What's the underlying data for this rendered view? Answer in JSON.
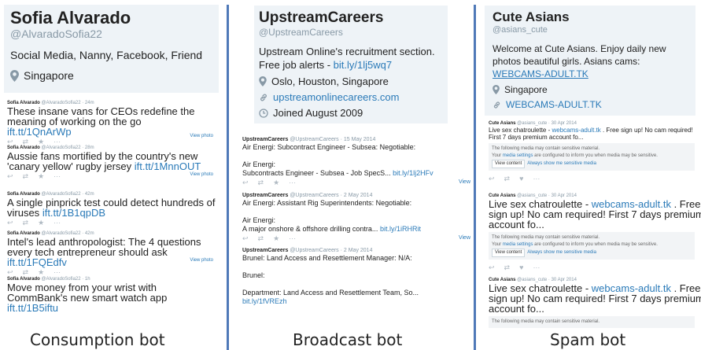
{
  "columns": [
    {
      "profile": {
        "name": "Sofia Alvarado",
        "handle": "@AlvaradoSofia22",
        "bio": "Social Media, Nanny, Facebook, Friend",
        "location": "Singapore"
      },
      "tweets": [
        {
          "name": "Sofia Alvarado",
          "meta": "@AlvaradoSofia22 · 24m",
          "text": "These insane vans for CEOs redefine the meaning of working on the go",
          "link": "ift.tt/1QnArWp",
          "view_photo": "View photo"
        },
        {
          "name": "Sofia Alvarado",
          "meta": "@AlvaradoSofia22 · 28m",
          "text": "Aussie fans mortified by the country's new 'canary yellow' rugby jersey",
          "link": "ift.tt/1MnnOUT",
          "view_photo": "View photo"
        },
        {
          "name": "Sofia Alvarado",
          "meta": "@AlvaradoSofia22 · 42m",
          "text": "A single pinprick test could detect hundreds of viruses",
          "link": "ift.tt/1B1qpDB",
          "view_photo": ""
        },
        {
          "name": "Sofia Alvarado",
          "meta": "@AlvaradoSofia22 · 42m",
          "text": "Intel's lead anthropologist: The 4 questions every tech entrepreneur should ask",
          "link": "ift.tt/1FQEdfv",
          "view_photo": "View photo"
        },
        {
          "name": "Sofia Alvarado",
          "meta": "@AlvaradoSofia22 · 1h",
          "text": "Move money from your wrist with CommBank's new smart watch app",
          "link": "ift.tt/1B5iftu",
          "view_photo": ""
        }
      ],
      "caption": "Consumption bot"
    },
    {
      "profile": {
        "name": "UpstreamCareers",
        "handle": "@UpstreamCareers",
        "bio": "Upstream Online's recruitment section.\nFree job alerts - ",
        "bio_link": "bit.ly/1lj5wq7",
        "location": "Oslo, Houston, Singapore",
        "website": "upstreamonlinecareers.com",
        "joined": "Joined August 2009"
      },
      "tweets": [
        {
          "name": "UpstreamCareers",
          "meta": "@UpstreamCareers · 15 May 2014",
          "text": "Air Energi: Subcontract Engineer - Subsea: Negotiable:\n\nAir Energi:\nSubcontracts Engineer - Subsea - Job SpecS... ",
          "link": "bit.ly/1lj2HFv",
          "view_photo": "View"
        },
        {
          "name": "UpstreamCareers",
          "meta": "@UpstreamCareers · 2 May 2014",
          "text": "Air Energi: Assistant Rig Superintendents: Negotiable:\n\nAir Energi:\nA major onshore & offshore drilling contra... ",
          "link": "bit.ly/1iRHRit",
          "view_photo": "View"
        },
        {
          "name": "UpstreamCareers",
          "meta": "@UpstreamCareers · 2 May 2014",
          "text": "Brunel: Land Access and Resettlement Manager: N/A:\n\nBrunel:\n\nDepartment: Land Access and Resettlement Team, So...\n",
          "link": "bit.ly/1fVREzh",
          "view_photo": ""
        }
      ],
      "caption": "Broadcast bot"
    },
    {
      "profile": {
        "name": "Cute Asians",
        "handle": "@asians_cute",
        "bio": "Welcome at Cute Asians. Enjoy daily new\nphotos beautiful girls. Asians cams:\n",
        "bio_link": "WEBCAMS-ADULT.TK",
        "location": "Singapore",
        "website": "WEBCAMS-ADULT.TK"
      },
      "tweets": [
        {
          "name": "Cute Asians",
          "meta": "@asians_cute · 30 Apr 2014",
          "text_before": "Live sex chatroulette - ",
          "link": "webcams-adult.tk",
          "text_after": " . Free sign up! No cam required! First 7 days premium account fo...",
          "size": "small"
        },
        {
          "name": "Cute Asians",
          "meta": "@asians_cute · 30 Apr 2014",
          "text_before": "Live sex chatroulette - ",
          "link": "webcams-adult.tk",
          "text_after": " . Free sign up! No cam required! First 7 days premium account fo...",
          "size": "big"
        },
        {
          "name": "Cute Asians",
          "meta": "@asians_cute · 30 Apr 2014",
          "text_before": "Live sex chatroulette - ",
          "link": "webcams-adult.tk",
          "text_after": " . Free sign up! No cam required! First 7 days premium account fo...",
          "size": "big"
        }
      ],
      "sensitive": {
        "line1": "The following media may contain sensitive material.",
        "line2_a": "Your ",
        "line2_link": "media settings",
        "line2_b": " are configured to inform you when media may be sensitive.",
        "view_content": "View content",
        "always_show": "Always show me sensitive media"
      },
      "caption": "Spam bot"
    }
  ],
  "actions": {
    "reply": "↩",
    "retweet": "⇄",
    "favorite": "★",
    "favorite_heart": "♥",
    "more": "···"
  }
}
